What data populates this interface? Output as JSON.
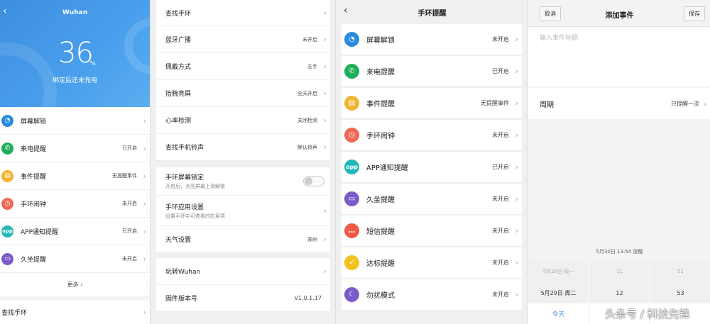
{
  "panel1": {
    "back": "‹",
    "device": "Wuhan",
    "battery": "36",
    "battery_unit": "%",
    "battery_status": "绑定后还未充电",
    "items": [
      {
        "label": "屏幕解锁",
        "value": "",
        "color": "#2b8be0",
        "icon": "lock-icon"
      },
      {
        "label": "来电提醒",
        "value": "已开启",
        "color": "#1fae5a",
        "icon": "phone-icon"
      },
      {
        "label": "事件提醒",
        "value": "无提醒事件",
        "color": "#f2b532",
        "icon": "calendar-icon"
      },
      {
        "label": "手环闹钟",
        "value": "未开启",
        "color": "#ee6a55",
        "icon": "alarm-icon"
      },
      {
        "label": "APP通知提醒",
        "value": "已开启",
        "color": "#22b8b8",
        "icon": "app-icon"
      },
      {
        "label": "久坐提醒",
        "value": "未开启",
        "color": "#7a5cc8",
        "icon": "sofa-icon"
      }
    ],
    "more": "更多 ›",
    "find_band": "查找手环"
  },
  "panel2": {
    "group1": [
      {
        "label": "查找手环",
        "value": ""
      },
      {
        "label": "蓝牙广播",
        "value": "未开启"
      },
      {
        "label": "佩戴方式",
        "value": "左手"
      },
      {
        "label": "抬腕亮屏",
        "value": "全天开启"
      },
      {
        "label": "心率检测",
        "value": "关闭检测"
      },
      {
        "label": "查找手机铃声",
        "value": "默认铃声"
      }
    ],
    "lock": {
      "label": "手环屏幕锁定",
      "sub": "开启后，点亮屏幕上滑解锁"
    },
    "apps": {
      "label": "手环应用设置",
      "sub": "设置手环中可查看的应用项"
    },
    "weather": {
      "label": "天气设置",
      "value": "郑州"
    },
    "play": {
      "label": "玩转Wuhan",
      "value": ""
    },
    "firmware": {
      "label": "固件版本号",
      "value": "V1.0.1.17"
    }
  },
  "panel3": {
    "back": "‹",
    "title": "手环提醒",
    "items": [
      {
        "label": "屏幕解锁",
        "value": "未开启",
        "color": "#2b8be0",
        "icon": "lock-icon",
        "glyph": "🔓"
      },
      {
        "label": "来电提醒",
        "value": "已开启",
        "color": "#1fae5a",
        "icon": "phone-icon",
        "glyph": "✆"
      },
      {
        "label": "事件提醒",
        "value": "无提醒事件",
        "color": "#f2b532",
        "icon": "calendar-icon",
        "glyph": "▤"
      },
      {
        "label": "手环闹钟",
        "value": "未开启",
        "color": "#ee6a55",
        "icon": "alarm-icon",
        "glyph": "◷"
      },
      {
        "label": "APP通知提醒",
        "value": "已开启",
        "color": "#22b8b8",
        "icon": "app-icon",
        "glyph": "app"
      },
      {
        "label": "久坐提醒",
        "value": "未开启",
        "color": "#7a5cc8",
        "icon": "sofa-icon",
        "glyph": "▭"
      },
      {
        "label": "短信提醒",
        "value": "未开启",
        "color": "#ee5a4a",
        "icon": "message-icon",
        "glyph": "…"
      },
      {
        "label": "达标提醒",
        "value": "未开启",
        "color": "#f2c21e",
        "icon": "shield-icon",
        "glyph": "✓"
      },
      {
        "label": "勿扰模式",
        "value": "未开启",
        "color": "#7a5cc8",
        "icon": "moon-icon",
        "glyph": "☾"
      }
    ]
  },
  "panel4": {
    "cancel": "取消",
    "title": "添加事件",
    "save": "保存",
    "placeholder": "输入事件标题",
    "period_label": "周期",
    "period_value": "只提醒一次",
    "preview": "5月30日 13:54 提醒",
    "picker": {
      "dates": [
        "5月28日 周一",
        "5月29日 周二"
      ],
      "hours": [
        "11",
        "12"
      ],
      "minutes": [
        "52",
        "53"
      ]
    },
    "today": "今天"
  },
  "watermark": "头条号 / 科技先锋"
}
